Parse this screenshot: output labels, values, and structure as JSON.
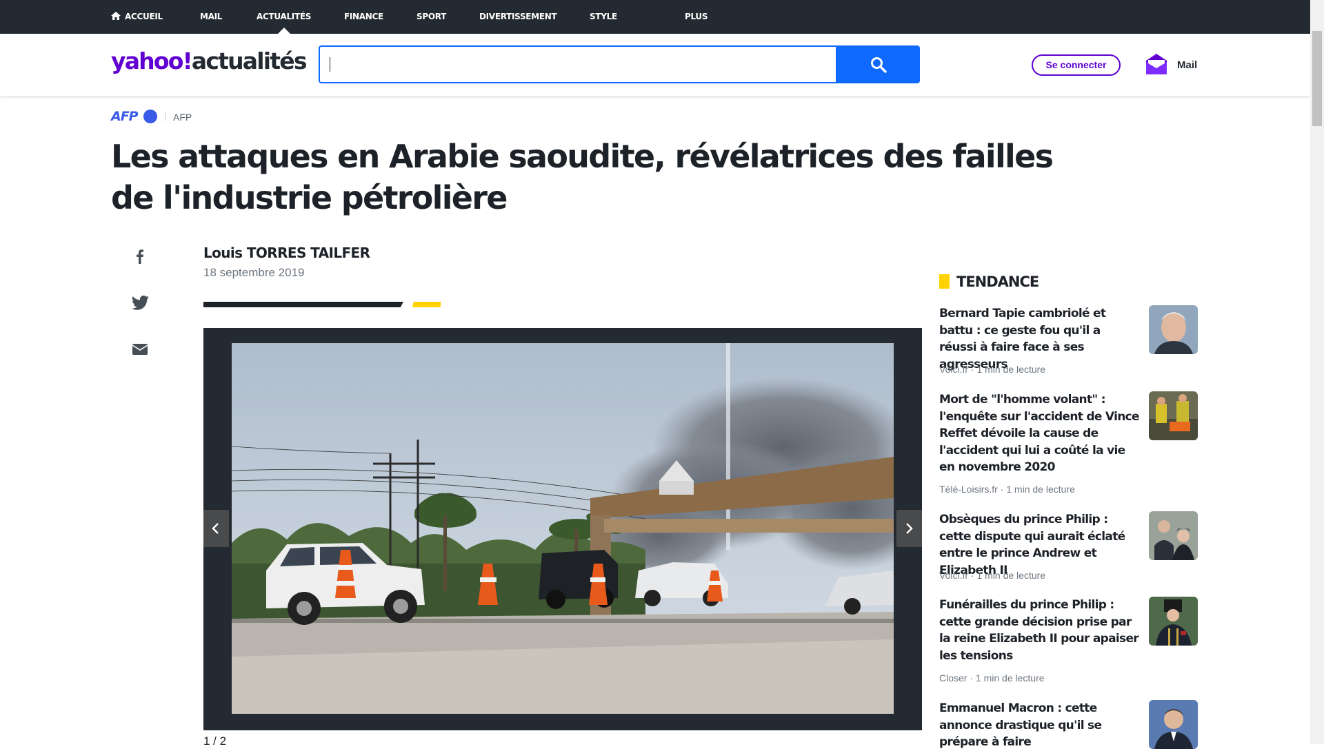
{
  "topnav": {
    "items": [
      {
        "label": "ACCUEIL",
        "icon": "home-icon"
      },
      {
        "label": "MAIL"
      },
      {
        "label": "ACTUALITÉS",
        "active": true
      },
      {
        "label": "FINANCE"
      },
      {
        "label": "SPORT"
      },
      {
        "label": "DIVERTISSEMENT"
      },
      {
        "label": "STYLE"
      },
      {
        "label": "PLUS"
      }
    ]
  },
  "header": {
    "logo_brand": "yahoo!",
    "logo_section": "actualités",
    "search_value": "",
    "search_icon": "search-icon",
    "signin_label": "Se connecter",
    "mail_label": "Mail",
    "mail_icon": "envelope-icon"
  },
  "article": {
    "source_logo": "AFP",
    "source_name": "AFP",
    "headline": "Les attaques en Arabie saoudite, révélatrices des failles de l'industrie pétrolière",
    "author": "Louis TORRES TAILFER",
    "date": "18 septembre 2019",
    "share_icons": [
      "facebook-icon",
      "twitter-icon",
      "email-icon"
    ],
    "slide_counter": "1 / 2"
  },
  "trending": {
    "title": "TENDANCE",
    "items": [
      {
        "title": "Bernard Tapie cambriolé et battu : ce geste fou qu'il a réussi à faire face à ses agresseurs",
        "source": "Voici.fr",
        "read_time": "1 min de lecture"
      },
      {
        "title": "Mort de \"l'homme volant\" : l'enquête sur l'accident de Vince Reffet dévoile la cause de l'accident qui lui a coûté la vie en novembre 2020",
        "source": "Télé-Loisirs.fr",
        "read_time": "1 min de lecture"
      },
      {
        "title": "Obsèques du prince Philip : cette dispute qui aurait éclaté entre le prince Andrew et Elizabeth II",
        "source": "Voici.fr",
        "read_time": "1 min de lecture"
      },
      {
        "title": "Funérailles du prince Philip : cette grande décision prise par la reine Elizabeth II pour apaiser les tensions",
        "source": "Closer",
        "read_time": "1 min de lecture"
      },
      {
        "title": "Emmanuel Macron : cette annonce drastique qu'il se prépare à faire",
        "source": "",
        "read_time": ""
      }
    ]
  },
  "colors": {
    "brand_purple": "#6001d2",
    "search_blue": "#0f69ff",
    "nav_dark": "#232a31",
    "accent_yellow": "#ffd200",
    "afp_blue": "#3a5ae8"
  }
}
